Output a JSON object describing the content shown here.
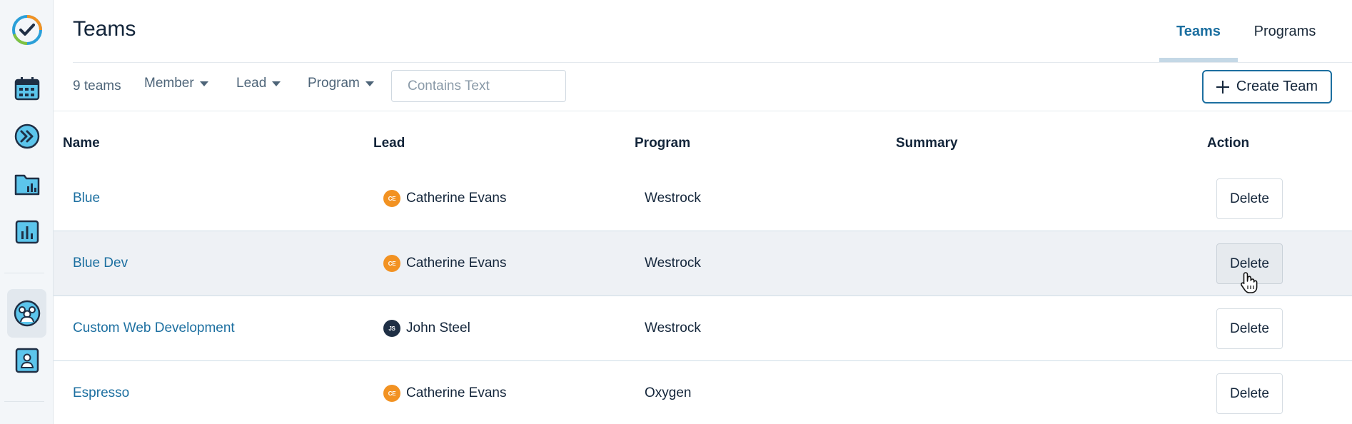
{
  "sidebar": {
    "items": [
      {
        "icon": "app-logo-icon"
      },
      {
        "icon": "calendar-icon"
      },
      {
        "icon": "fast-forward-icon"
      },
      {
        "icon": "folder-chart-icon"
      },
      {
        "icon": "bar-chart-icon"
      },
      {
        "icon": "teams-icon",
        "active": true
      },
      {
        "icon": "user-badge-icon"
      }
    ]
  },
  "header": {
    "title": "Teams",
    "tabs": [
      {
        "label": "Teams",
        "active": true
      },
      {
        "label": "Programs",
        "active": false
      }
    ]
  },
  "toolbar": {
    "count": "9 teams",
    "filters": [
      {
        "label": "Member"
      },
      {
        "label": "Lead"
      },
      {
        "label": "Program"
      }
    ],
    "search": {
      "placeholder": "Contains Text",
      "value": ""
    },
    "create_label": "Create Team"
  },
  "table": {
    "columns": [
      "Name",
      "Lead",
      "Program",
      "Summary",
      "Action"
    ],
    "rows": [
      {
        "name": "Blue",
        "lead": "Catherine Evans",
        "lead_initials": "CE",
        "program": "Westrock",
        "summary": "",
        "action": "Delete"
      },
      {
        "name": "Blue Dev",
        "lead": "Catherine Evans",
        "lead_initials": "CE",
        "program": "Westrock",
        "summary": "",
        "action": "Delete"
      },
      {
        "name": "Custom Web Development",
        "lead": "John Steel",
        "lead_initials": "JS",
        "program": "Westrock",
        "summary": "",
        "action": "Delete"
      },
      {
        "name": "Espresso",
        "lead": "Catherine Evans",
        "lead_initials": "CE",
        "program": "Oxygen",
        "summary": "",
        "action": "Delete"
      }
    ]
  },
  "colors": {
    "accent": "#1c6fa0",
    "avatar_orange": "#f29222",
    "avatar_navy": "#1f2f45",
    "hover_row": "#eef1f5"
  }
}
